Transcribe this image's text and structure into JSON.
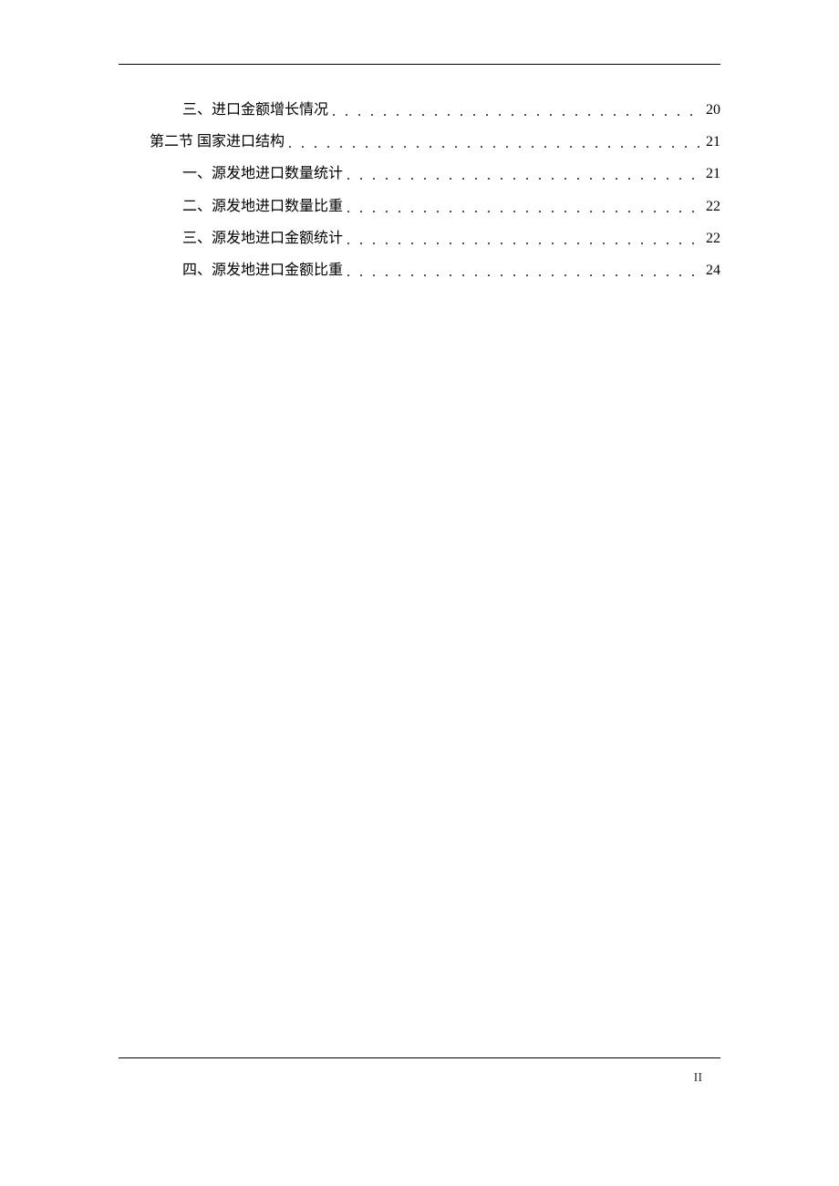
{
  "toc": {
    "entries": [
      {
        "level": 2,
        "label": "三、进口金额增长情况",
        "page": "20"
      },
      {
        "level": 1,
        "label": "第二节 国家进口结构",
        "page": "21"
      },
      {
        "level": 2,
        "label": "一、源发地进口数量统计",
        "page": "21"
      },
      {
        "level": 2,
        "label": "二、源发地进口数量比重",
        "page": "22"
      },
      {
        "level": 2,
        "label": "三、源发地进口金额统计",
        "page": "22"
      },
      {
        "level": 2,
        "label": "四、源发地进口金额比重",
        "page": "24"
      }
    ]
  },
  "page_number": "II"
}
